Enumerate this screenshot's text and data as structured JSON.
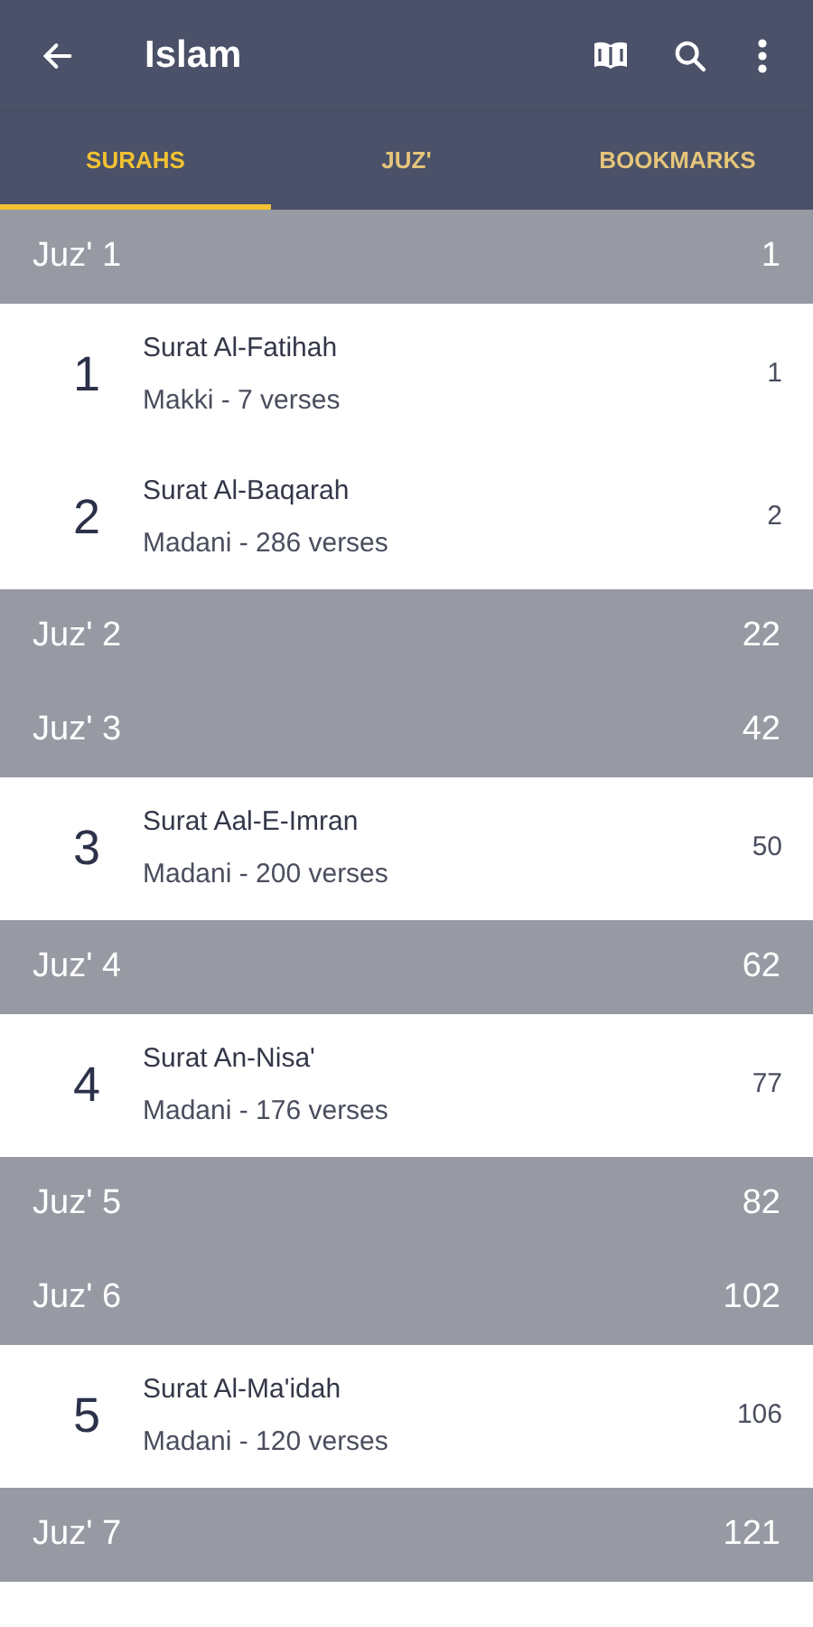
{
  "app_bar": {
    "title": "Islam"
  },
  "tabs": [
    {
      "label": "SURAHS",
      "selected": true
    },
    {
      "label": "JUZ'",
      "selected": false
    },
    {
      "label": "BOOKMARKS",
      "selected": false
    }
  ],
  "rows": [
    {
      "kind": "juz",
      "label": "Juz' 1",
      "page": "1"
    },
    {
      "kind": "surah",
      "number": "1",
      "name": "Surat Al-Fatihah",
      "details": "Makki - 7 verses",
      "page": "1"
    },
    {
      "kind": "surah",
      "number": "2",
      "name": "Surat Al-Baqarah",
      "details": "Madani - 286 verses",
      "page": "2"
    },
    {
      "kind": "juz",
      "label": "Juz' 2",
      "page": "22"
    },
    {
      "kind": "juz",
      "label": "Juz' 3",
      "page": "42"
    },
    {
      "kind": "surah",
      "number": "3",
      "name": "Surat Aal-E-Imran",
      "details": "Madani - 200 verses",
      "page": "50"
    },
    {
      "kind": "juz",
      "label": "Juz' 4",
      "page": "62"
    },
    {
      "kind": "surah",
      "number": "4",
      "name": "Surat An-Nisa'",
      "details": "Madani - 176 verses",
      "page": "77"
    },
    {
      "kind": "juz",
      "label": "Juz' 5",
      "page": "82"
    },
    {
      "kind": "juz",
      "label": "Juz' 6",
      "page": "102"
    },
    {
      "kind": "surah",
      "number": "5",
      "name": "Surat Al-Ma'idah",
      "details": "Madani - 120 verses",
      "page": "106"
    },
    {
      "kind": "juz",
      "label": "Juz' 7",
      "page": "121"
    }
  ]
}
